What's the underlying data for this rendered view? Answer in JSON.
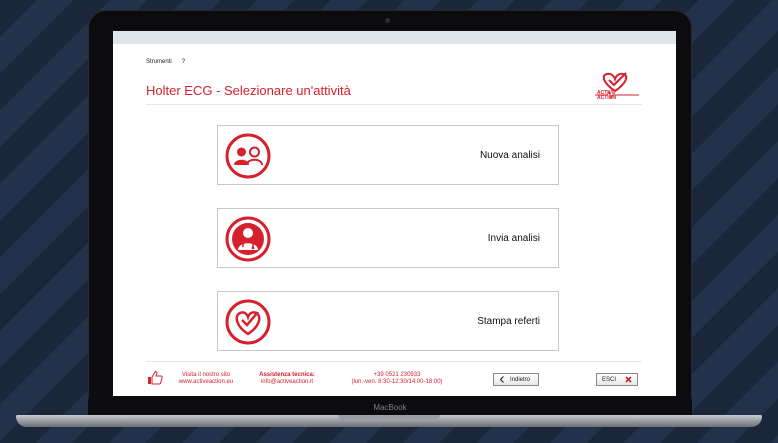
{
  "device": {
    "brand_label": "MacBook"
  },
  "menu": {
    "items": [
      "Strumenti",
      "?"
    ]
  },
  "page": {
    "title": "Holter ECG - Selezionare un'attività"
  },
  "logo": {
    "text_line1": "ACTIVE",
    "text_line2": "ACTION"
  },
  "actions": [
    {
      "label": "Nuova analisi",
      "icon": "users-icon"
    },
    {
      "label": "Invia analisi",
      "icon": "doctor-icon"
    },
    {
      "label": "Stampa referti",
      "icon": "heart-check-icon"
    }
  ],
  "footer": {
    "visit_line1": "Visita il nostro sito",
    "visit_line2": "www.activeaction.eu",
    "support_title": "Assistenza tecnica:",
    "support_email": "info@activeaction.it",
    "phone": "+39 0521 230933",
    "hours": "(lun.-ven. 8:30-12:30/14:00-18:00)",
    "back_label": "Indietro",
    "exit_label": "ESCI"
  },
  "colors": {
    "accent": "#d6202e",
    "background": "#1d2b3e"
  }
}
